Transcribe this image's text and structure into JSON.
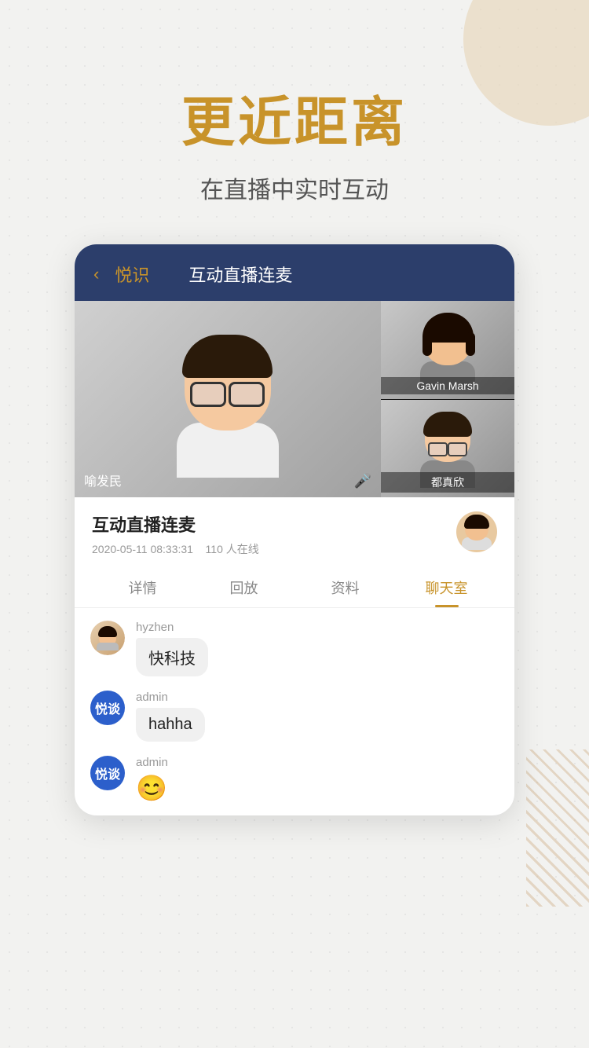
{
  "page": {
    "bg_color": "#f2f2f0"
  },
  "hero": {
    "main_title": "更近距离",
    "sub_title": "在直播中实时互动"
  },
  "card": {
    "header": {
      "back_label": "‹",
      "app_name": "悦识",
      "title": "互动直播连麦"
    },
    "video": {
      "main_presenter_name": "喻发民",
      "mic_icon": "🎤",
      "side_presenter1_name": "Gavin Marsh",
      "side_presenter2_name": "都真欣"
    },
    "info": {
      "title": "互动直播连麦",
      "date": "2020-05-11 08:33:31",
      "online_count": "110 人在线"
    },
    "tabs": [
      {
        "id": "details",
        "label": "详情",
        "active": false
      },
      {
        "id": "replay",
        "label": "回放",
        "active": false
      },
      {
        "id": "materials",
        "label": "资料",
        "active": false
      },
      {
        "id": "chat",
        "label": "聊天室",
        "active": true
      }
    ],
    "chat": {
      "messages": [
        {
          "id": 1,
          "avatar_type": "photo",
          "username": "hyzhen",
          "text": "快科技",
          "is_emoji": false
        },
        {
          "id": 2,
          "avatar_type": "yueshi",
          "username": "admin",
          "text": "hahha",
          "is_emoji": false
        },
        {
          "id": 3,
          "avatar_type": "yueshi",
          "username": "admin",
          "text": "😊",
          "is_emoji": true
        }
      ],
      "yueshi_label": "悦谈"
    }
  }
}
